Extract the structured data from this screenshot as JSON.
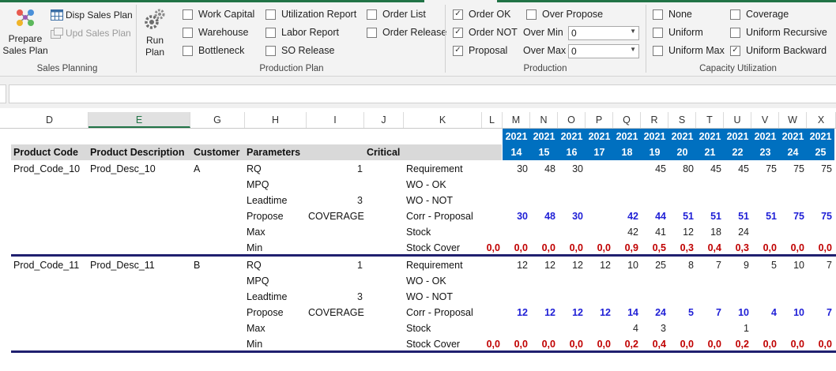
{
  "ribbon": {
    "sales_planning": {
      "label": "Sales Planning",
      "prepare_line1": "Prepare",
      "prepare_line2": "Sales Plan",
      "disp": "Disp Sales Plan",
      "upd": "Upd Sales Plan"
    },
    "production_plan": {
      "label": "Production Plan",
      "run_line1": "Run",
      "run_line2": "Plan",
      "checkboxes": [
        {
          "label": "Work Capital",
          "checked": false
        },
        {
          "label": "Warehouse",
          "checked": false
        },
        {
          "label": "Bottleneck",
          "checked": false
        },
        {
          "label": "Utilization Report",
          "checked": false
        },
        {
          "label": "Labor Report",
          "checked": false
        },
        {
          "label": "SO Release",
          "checked": false
        },
        {
          "label": "Order List",
          "checked": false
        },
        {
          "label": "Order Release",
          "checked": false
        }
      ]
    },
    "production": {
      "label": "Production",
      "checkboxes": [
        {
          "label": "Order OK",
          "checked": true
        },
        {
          "label": "Order NOT",
          "checked": true
        },
        {
          "label": "Proposal",
          "checked": true
        },
        {
          "label": "Over Propose",
          "checked": false
        }
      ],
      "over_min_label": "Over Min",
      "over_min_value": "0",
      "over_max_label": "Over Max",
      "over_max_value": "0"
    },
    "capacity": {
      "label": "Capacity Utilization",
      "checkboxes": [
        {
          "label": "None",
          "checked": false
        },
        {
          "label": "Uniform",
          "checked": false
        },
        {
          "label": "Uniform Max",
          "checked": false
        },
        {
          "label": "Coverage",
          "checked": false
        },
        {
          "label": "Uniform Recursive",
          "checked": false
        },
        {
          "label": "Uniform Backward",
          "checked": true
        }
      ]
    }
  },
  "sheet": {
    "columns": [
      "D",
      "E",
      "G",
      "H",
      "I",
      "J",
      "K",
      "L",
      "M",
      "N",
      "O",
      "P",
      "Q",
      "R",
      "S",
      "T",
      "U",
      "V",
      "W",
      "X"
    ],
    "selected_column": "E",
    "week_year": "2021",
    "weeks": [
      "14",
      "15",
      "16",
      "17",
      "18",
      "19",
      "20",
      "21",
      "22",
      "23",
      "24",
      "25"
    ],
    "headers": {
      "product_code": "Product Code",
      "product_description": "Product Description",
      "customer": "Customer",
      "parameters": "Parameters",
      "critical": "Critical"
    },
    "products": [
      {
        "code": "Prod_Code_10",
        "desc": "Prod_Desc_10",
        "customer": "A",
        "params": [
          {
            "name": "RQ",
            "value": "1"
          },
          {
            "name": "MPQ",
            "value": ""
          },
          {
            "name": "Leadtime",
            "value": "3"
          },
          {
            "name": "Propose",
            "value": "COVERAGE"
          },
          {
            "name": "Max",
            "value": ""
          },
          {
            "name": "Min",
            "value": ""
          }
        ],
        "measures": [
          {
            "name": "Requirement",
            "style": "",
            "L": "",
            "values": [
              "30",
              "48",
              "30",
              "",
              "",
              "45",
              "80",
              "45",
              "45",
              "75",
              "75",
              "75"
            ]
          },
          {
            "name": "WO - OK",
            "style": "",
            "L": "",
            "values": [
              "",
              "",
              "",
              "",
              "",
              "",
              "",
              "",
              "",
              "",
              "",
              ""
            ]
          },
          {
            "name": "WO - NOT",
            "style": "",
            "L": "",
            "values": [
              "",
              "",
              "",
              "",
              "",
              "",
              "",
              "",
              "",
              "",
              "",
              ""
            ]
          },
          {
            "name": "Corr - Proposal",
            "style": "blue",
            "L": "",
            "values": [
              "30",
              "48",
              "30",
              "",
              "42",
              "44",
              "51",
              "51",
              "51",
              "51",
              "75",
              "75"
            ]
          },
          {
            "name": "Stock",
            "style": "",
            "L": "",
            "values": [
              "",
              "",
              "",
              "",
              "42",
              "41",
              "12",
              "18",
              "24",
              "",
              "",
              ""
            ]
          },
          {
            "name": "Stock Cover",
            "style": "red",
            "L": "0,0",
            "values": [
              "0,0",
              "0,0",
              "0,0",
              "0,0",
              "0,9",
              "0,5",
              "0,3",
              "0,4",
              "0,3",
              "0,0",
              "0,0",
              "0,0"
            ]
          }
        ]
      },
      {
        "code": "Prod_Code_11",
        "desc": "Prod_Desc_11",
        "customer": "B",
        "params": [
          {
            "name": "RQ",
            "value": "1"
          },
          {
            "name": "MPQ",
            "value": ""
          },
          {
            "name": "Leadtime",
            "value": "3"
          },
          {
            "name": "Propose",
            "value": "COVERAGE"
          },
          {
            "name": "Max",
            "value": ""
          },
          {
            "name": "Min",
            "value": ""
          }
        ],
        "measures": [
          {
            "name": "Requirement",
            "style": "",
            "L": "",
            "values": [
              "12",
              "12",
              "12",
              "12",
              "10",
              "25",
              "8",
              "7",
              "9",
              "5",
              "10",
              "7"
            ]
          },
          {
            "name": "WO - OK",
            "style": "",
            "L": "",
            "values": [
              "",
              "",
              "",
              "",
              "",
              "",
              "",
              "",
              "",
              "",
              "",
              ""
            ]
          },
          {
            "name": "WO - NOT",
            "style": "",
            "L": "",
            "values": [
              "",
              "",
              "",
              "",
              "",
              "",
              "",
              "",
              "",
              "",
              "",
              ""
            ]
          },
          {
            "name": "Corr - Proposal",
            "style": "blue",
            "L": "",
            "values": [
              "12",
              "12",
              "12",
              "12",
              "14",
              "24",
              "5",
              "7",
              "10",
              "4",
              "10",
              "7"
            ]
          },
          {
            "name": "Stock",
            "style": "",
            "L": "",
            "values": [
              "",
              "",
              "",
              "",
              "4",
              "3",
              "",
              "",
              "1",
              "",
              "",
              ""
            ]
          },
          {
            "name": "Stock Cover",
            "style": "red",
            "L": "0,0",
            "values": [
              "0,0",
              "0,0",
              "0,0",
              "0,0",
              "0,2",
              "0,4",
              "0,0",
              "0,0",
              "0,2",
              "0,0",
              "0,0",
              "0,0"
            ]
          }
        ]
      }
    ]
  }
}
